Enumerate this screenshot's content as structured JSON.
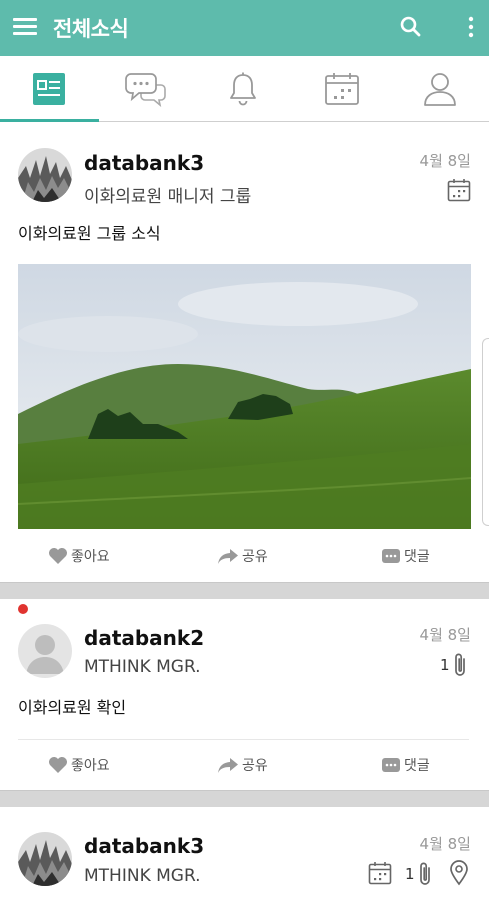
{
  "header": {
    "title": "전체소식",
    "menu_icon": "hamburger-menu-icon",
    "search_icon": "search-icon",
    "more_icon": "more-vert-icon",
    "color": "#5ebbac"
  },
  "tabs": [
    {
      "name": "feed",
      "icon": "news-feed-icon",
      "active": true
    },
    {
      "name": "chat",
      "icon": "chat-bubbles-icon",
      "active": false
    },
    {
      "name": "notifications",
      "icon": "bell-icon",
      "active": false
    },
    {
      "name": "calendar",
      "icon": "calendar-icon",
      "active": false
    },
    {
      "name": "profile",
      "icon": "person-icon",
      "active": false
    }
  ],
  "accent_color": "#3ab0a0",
  "posts": [
    {
      "author": "databank3",
      "group": "이화의료원 매니저 그룹",
      "date": "4월 8일",
      "text": "이화의료원 그룹 소식",
      "has_calendar": true,
      "has_image": true,
      "actions": {
        "like": "좋아요",
        "share": "공유",
        "comment": "댓글"
      }
    },
    {
      "author": "databank2",
      "group": "MTHINK MGR.",
      "date": "4월 8일",
      "text": "이화의료원 확인",
      "attachments": "1",
      "unread": true,
      "unread_color": "#e0332f",
      "actions": {
        "like": "좋아요",
        "share": "공유",
        "comment": "댓글"
      }
    },
    {
      "author": "databank3",
      "group": "MTHINK MGR.",
      "date": "4월 8일",
      "attachments": "1",
      "has_calendar": true,
      "has_location": true
    }
  ]
}
